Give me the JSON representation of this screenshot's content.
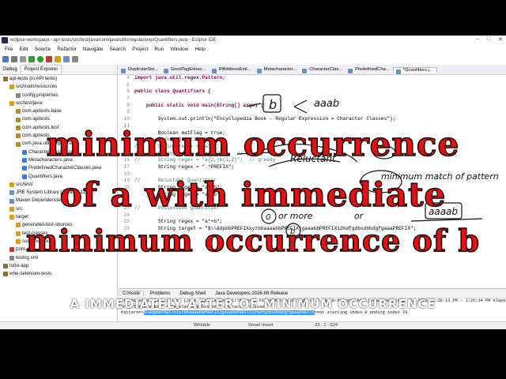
{
  "window": {
    "title": "eclipse-workspace - api-tests/src/test/java/com/java/utils/regular/exp/Quantifiers.java - Eclipse IDE"
  },
  "menu": [
    "File",
    "Edit",
    "Source",
    "Refactor",
    "Navigate",
    "Search",
    "Project",
    "Run",
    "Window",
    "Help"
  ],
  "left_tabs": [
    "Debug",
    "Project Explorer"
  ],
  "tree": [
    "api-tests (in API tests)",
    "src/main/resources",
    "config.properties",
    "src/test/java",
    "com.apitests.base",
    "com.apitests.",
    "com.apitests.test",
    "com.apitests.",
    "com.java.utils.regular.exp",
    "CharacterClasses.java",
    "Metacharacters.java",
    "PredefinedCharacterClasses.java",
    "Quantifiers.java",
    "src/test/",
    "JRE System Library [JavaSE-11]",
    "Maven Dependencies",
    "src",
    "target",
    "generated-test-sources",
    "test-classes",
    "surefire-reports",
    "pom.xml",
    "testng.xml",
    "todo-app",
    "whe-selenium-tests"
  ],
  "editor_tabs": [
    "DuplicateStri...",
    "GoodTagExtrac...",
    "IPAddressExtr...",
    "Metacharacter...",
    "CharacterClas...",
    "PredefinedCha...",
    "*Quantifiers.j..."
  ],
  "code": [
    {
      "n": "4",
      "t": "import java.util.regex.Pattern;"
    },
    {
      "n": "5",
      "t": ""
    },
    {
      "n": "6",
      "t": "public class Quantifiers {"
    },
    {
      "n": "7",
      "t": ""
    },
    {
      "n": "8",
      "t": "    public static void main(String[] args) {"
    },
    {
      "n": "9",
      "t": ""
    },
    {
      "n": "10",
      "t": "        System.out.println(\"Encyclopedia Book - Regular Expression = Character Classes\");"
    },
    {
      "n": "11",
      "t": ""
    },
    {
      "n": "12",
      "t": "        Boolean matFlag = true;"
    },
    {
      "n": "13",
      "t": "//      Greedy Quantifier"
    },
    {
      "n": "14",
      "t": "//      String regex = \"a?b\";"
    },
    {
      "n": "15",
      "t": "//      String regex = \"a*b{2}\";   // greedy"
    },
    {
      "n": "16",
      "t": "//      String regex = \"a{2,}b{1,2}\";  // greedy"
    },
    {
      "n": "17",
      "t": "        String regex = \".*PREFIX\";"
    },
    {
      "n": "18",
      "t": ""
    },
    {
      "n": "19",
      "t": "//      Reluctant Quantifier"
    },
    {
      "n": "20",
      "t": "        String regex = \"a??b\";"
    },
    {
      "n": "21",
      "t": "        String regex = \"a*?b\";"
    },
    {
      "n": "22",
      "t": ""
    },
    {
      "n": "23",
      "t": "//      Possessive Quantifier"
    },
    {
      "n": "24",
      "t": ""
    },
    {
      "n": "25",
      "t": "        String regex = \"a*+b\";"
    },
    {
      "n": "26",
      "t": "        String target = \"$\\\\&dpbbPREFIXxyzbbaaaabbPREFIXjgaaabbPREFIX12%dfgdbsdbbdgfgaaaPREFIX\";"
    }
  ],
  "console": {
    "tabs": [
      "Console",
      "Problems",
      "Debug Shell",
      "Java Developers 2026-06 Release"
    ],
    "terminated": "<terminated> Quantifiers [Java Application] C:\\Program Files\\Microsoft\\jdk-17.0.19.10-hotspot\\bin\\javaw.exe  (Aug 15, 2026, 1:26:13 PM - 1:26:14 PM elapsed 0:00:00) [pid: 31016]",
    "line1": "Encyclopedia Book = Regular Expression = Character Classes",
    "prefix": "Pattern=>",
    "match": "$\\&dpbbPREFIXxyzbbaaaabbPREFIXjgaaabbPREFIX12%dfgdbsdbbdgfgaaaPREFIX",
    "suffix": "<=at starting index 0 ending index 70"
  },
  "status": {
    "writable": "Writable",
    "insert": "Smart Insert",
    "pos": "23 : 1 : 524"
  },
  "overlay": {
    "line1": "minimum occurrence",
    "line2": "of a with immediate",
    "line3": "minimum occurrence of b",
    "subtitle": "a immediately after of minimum occurrence"
  },
  "annotations": {
    "b": "b",
    "aaab": "aaab",
    "reluctant": "Reluctant",
    "minmatch": "minimum match of pattern",
    "zero": "0",
    "ormore": "or more",
    "or": "or",
    "aaaab": "aaaab",
    "circle_b": "b"
  },
  "colors": {
    "caption_red": "#e31212",
    "keyword": "#7f0055",
    "string": "#2a00ff",
    "comment": "#3f7f5f",
    "selection": "#3399ff"
  }
}
